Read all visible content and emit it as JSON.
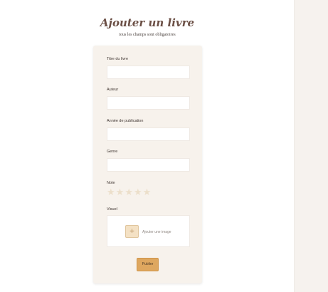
{
  "page": {
    "title": "Ajouter un livre",
    "subtitle": "tous les champs sont obligatoires"
  },
  "form": {
    "fields": [
      {
        "label": "Titre du livre",
        "value": ""
      },
      {
        "label": "Auteur",
        "value": ""
      },
      {
        "label": "Année de publication",
        "value": ""
      },
      {
        "label": "Genre",
        "value": ""
      }
    ],
    "rating": {
      "label": "Note",
      "value": 0,
      "max": 5,
      "star_glyph": "★",
      "empty_color": "#ecdfca"
    },
    "visual": {
      "label": "Visuel",
      "upload_icon": "plus-icon",
      "upload_glyph": "+",
      "upload_text": "Ajouter une image"
    },
    "submit_label": "Publier"
  },
  "colors": {
    "accent": "#dea75f",
    "title": "#6b4f45",
    "card_background": "#f7f2ec"
  }
}
